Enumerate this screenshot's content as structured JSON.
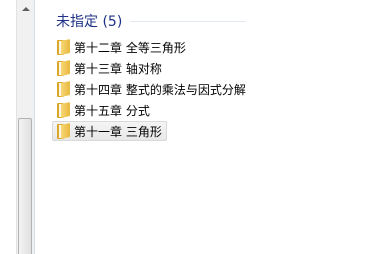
{
  "group": {
    "title": "未指定 (5)"
  },
  "items": [
    {
      "label": "第十二章 全等三角形"
    },
    {
      "label": "第十三章 轴对称"
    },
    {
      "label": "第十四章 整式的乘法与因式分解"
    },
    {
      "label": "第十五章 分式"
    },
    {
      "label": "第十一章 三角形"
    }
  ],
  "icons": {
    "folder": "folder-icon"
  },
  "colors": {
    "group_title": "#1e3287",
    "folder": "#e9b73c",
    "selection": "#e8e8e8"
  }
}
